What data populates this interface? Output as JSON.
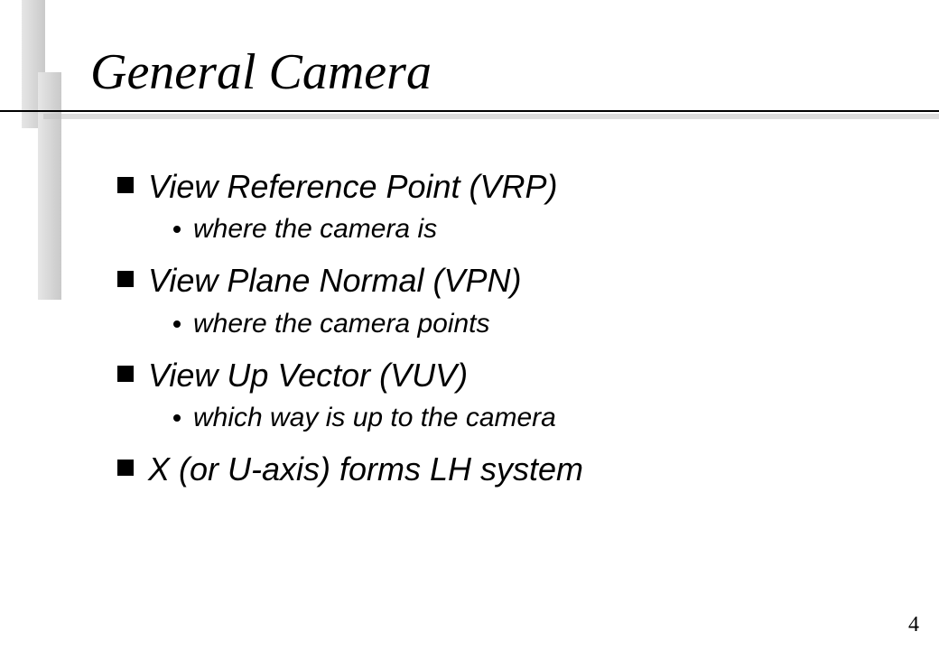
{
  "title": "General Camera",
  "bullets": [
    {
      "text": "View Reference Point (VRP)",
      "sub": [
        {
          "text": "where the camera is"
        }
      ]
    },
    {
      "text": "View Plane Normal (VPN)",
      "sub": [
        {
          "text": "where the camera points"
        }
      ]
    },
    {
      "text": "View Up Vector (VUV)",
      "sub": [
        {
          "text": "which way is up to the camera"
        }
      ]
    },
    {
      "text": "X (or U-axis) forms  LH system",
      "sub": []
    }
  ],
  "page_number": "4"
}
